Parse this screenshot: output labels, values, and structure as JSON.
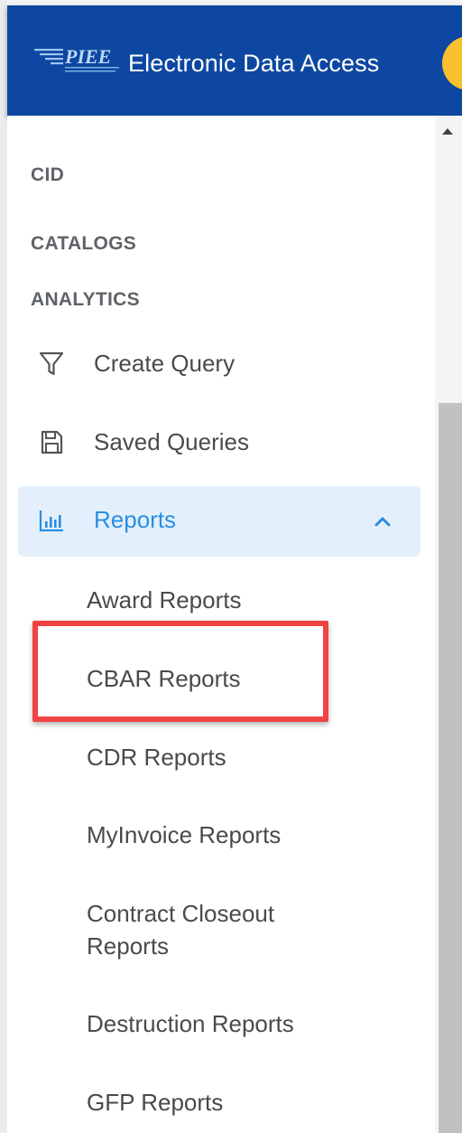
{
  "header": {
    "logo_text": "PIEE",
    "title": "Electronic Data Access",
    "colors": {
      "bar": "#0d47a1",
      "avatar": "#fbc02d"
    }
  },
  "sidebar": {
    "sections": [
      {
        "label": "CID"
      },
      {
        "label": "CATALOGS"
      },
      {
        "label": "ANALYTICS"
      }
    ],
    "items": [
      {
        "label": "Create Query",
        "icon": "filter-icon"
      },
      {
        "label": "Saved Queries",
        "icon": "save-icon"
      },
      {
        "label": "Reports",
        "icon": "bar-chart-icon",
        "expanded": true,
        "active": true
      }
    ],
    "report_items": [
      {
        "label": "Award Reports"
      },
      {
        "label": "CBAR Reports",
        "highlighted": true
      },
      {
        "label": "CDR Reports"
      },
      {
        "label": "MyInvoice Reports"
      },
      {
        "label": "Contract Closeout Reports"
      },
      {
        "label": "Destruction Reports"
      },
      {
        "label": "GFP Reports"
      }
    ],
    "colors": {
      "active_bg": "#e3f0fc",
      "active_text": "#2a8de2",
      "highlight": "#f04343"
    }
  }
}
